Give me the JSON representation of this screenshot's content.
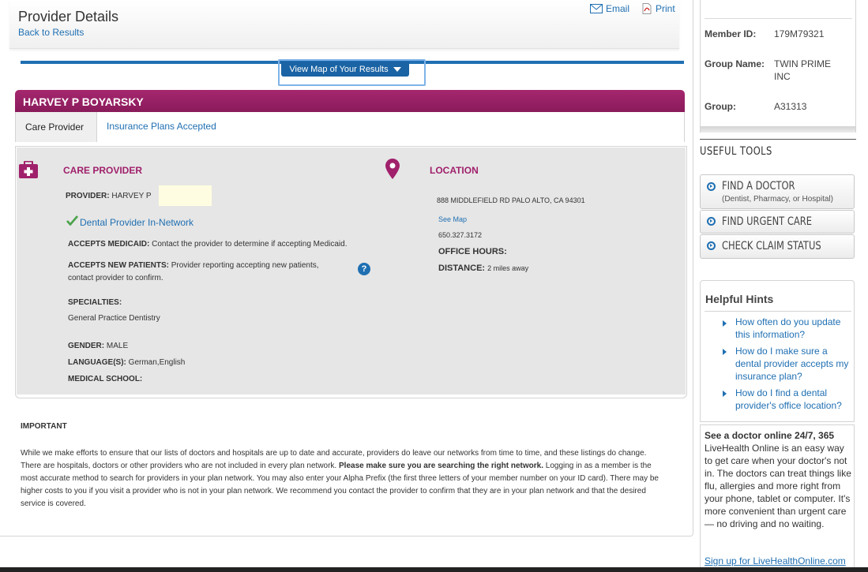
{
  "header": {
    "title": "Provider Details",
    "back_link": "Back to Results",
    "email_label": "Email",
    "print_label": "Print",
    "email_icon": "envelope-icon",
    "print_icon": "pdf-icon"
  },
  "map_button": {
    "label": "View Map of Your Results"
  },
  "provider": {
    "name": "HARVEY P BOYARSKY",
    "tabs": [
      "Care Provider",
      "Insurance Plans Accepted"
    ],
    "care": {
      "heading": "CARE PROVIDER",
      "provider_label": "PROVIDER:",
      "provider_value": "HARVEY P",
      "network": "Dental Provider In-Network",
      "medicaid_label": "ACCEPTS MEDICAID:",
      "medicaid_value": "Contact the provider to determine if accepting Medicaid.",
      "new_patients_label": "ACCEPTS NEW PATIENTS:",
      "new_patients_value": "Provider reporting accepting new patients,",
      "new_patients_value2": "contact provider to confirm.",
      "specialties_label": "SPECIALTIES:",
      "specialties_value": "General Practice Dentistry",
      "gender_label": "GENDER:",
      "gender_value": "MALE",
      "language_label": "LANGUAGE(S):",
      "language_value": "German,English",
      "school_label": "MEDICAL SCHOOL:"
    },
    "location": {
      "heading": "LOCATION",
      "address": "888 MIDDLEFIELD RD PALO ALTO, CA 94301",
      "see_map": "See Map",
      "phone": "650.327.3172",
      "hours_label": "OFFICE HOURS:",
      "distance_label": "DISTANCE:",
      "distance_value": "2 miles away"
    }
  },
  "important": {
    "title": "IMPORTANT",
    "text_a": "While we make efforts to ensure that our lists of doctors and hospitals are up to date and accurate, providers do leave our networks from time to time, and these listings do change. There are hospitals, doctors or other providers who are not included in every plan network. ",
    "text_bold": "Please make sure you are searching the right network.",
    "text_b": " Logging in as a member is the most accurate method to search for providers in your plan network. You may also enter your Alpha Prefix (the first three letters of your member number on your ID card). There may be higher costs to you if you visit a provider who is not in your plan network. We recommend you contact the provider to confirm that they are in your plan network and that the desired service is covered."
  },
  "member": {
    "id_label": "Member ID:",
    "id_value": "179M79321",
    "group_name_label": "Group Name:",
    "group_name_value": "TWIN PRIME INC",
    "group_label": "Group:",
    "group_value": "A31313"
  },
  "tools": {
    "title": "USEFUL TOOLS",
    "find_doctor": "FIND A DOCTOR",
    "find_doctor_sub": "(Dentist, Pharmacy, or Hospital)",
    "urgent_care": "FIND URGENT CARE",
    "claim_status": "CHECK CLAIM STATUS"
  },
  "hints": {
    "title": "Helpful Hints",
    "items": [
      "How often do you update this information?",
      "How do I make sure a dental provider accepts my insurance plan?",
      "How do I find a dental provider's office location?"
    ]
  },
  "lho": {
    "bold": "See a doctor online 24/7, 365",
    "text": " LiveHealth Online is an easy way to get care when your doctor's not in. The doctors can treat things like flu, allergies and more right from your phone, tablet or computer. It's more convenient than urgent care — no driving and no waiting.",
    "link": "Sign up for LiveHealthOnline.com"
  },
  "colors": {
    "accent_blue": "#1f6fb2",
    "brand_magenta": "#a0206b",
    "check_green": "#4aa24a"
  }
}
